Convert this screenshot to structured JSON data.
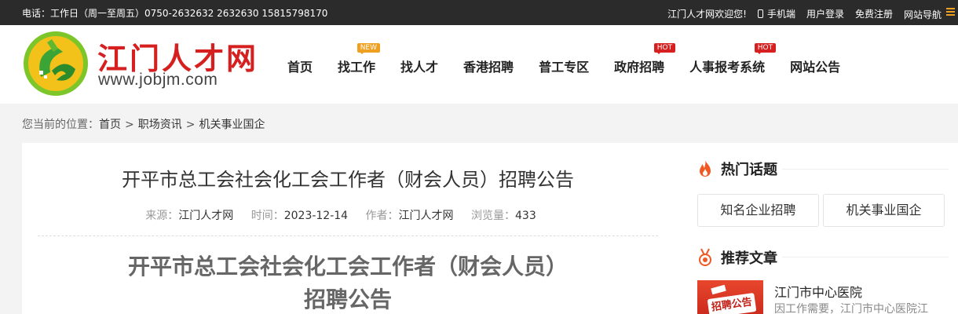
{
  "topbar": {
    "contact": "电话：工作日（周一至周五）0750-2632632 2632630 15815798170",
    "welcome": "江门人才网欢迎您!",
    "mobile": "手机端",
    "login": "用户登录",
    "register": "免费注册",
    "sitemap": "网站导航"
  },
  "logo": {
    "name": "江门人才网",
    "url": "www.jobjm.com"
  },
  "nav": {
    "items": [
      {
        "label": "首页",
        "badge": ""
      },
      {
        "label": "找工作",
        "badge": "NEW"
      },
      {
        "label": "找人才",
        "badge": ""
      },
      {
        "label": "香港招聘",
        "badge": ""
      },
      {
        "label": "普工专区",
        "badge": ""
      },
      {
        "label": "政府招聘",
        "badge": "HOT"
      },
      {
        "label": "人事报考系统",
        "badge": "HOT"
      },
      {
        "label": "网站公告",
        "badge": ""
      }
    ]
  },
  "breadcrumb": {
    "prefix": "您当前的位置：",
    "items": [
      "首页",
      "职场资讯",
      "机关事业国企"
    ],
    "separator": ">"
  },
  "article": {
    "title": "开平市总工会社会化工会工作者（财会人员）招聘公告",
    "source_label": "来源：",
    "source": "江门人才网",
    "time_label": "时间：",
    "time": "2023-12-14",
    "author_label": "作者：",
    "author": "江门人才网",
    "views_label": "浏览量：",
    "views": "433",
    "heading_line1": "开平市总工会社会化工会工作者（财会人员）",
    "heading_line2": "招聘公告"
  },
  "sidebar": {
    "hot_title": "热门话题",
    "hot_tags": [
      "知名企业招聘",
      "机关事业国企"
    ],
    "rec_title": "推荐文章",
    "thumb_text": "招聘公告",
    "rec_items": [
      {
        "title": "江门市中心医院",
        "desc": "因工作需要，江门市中心医院江"
      }
    ]
  },
  "colors": {
    "brand_red": "#d62020",
    "topbar_bg": "#2b2b2b",
    "new_badge": "#f0a020",
    "hot_icon": "#f05a22"
  }
}
